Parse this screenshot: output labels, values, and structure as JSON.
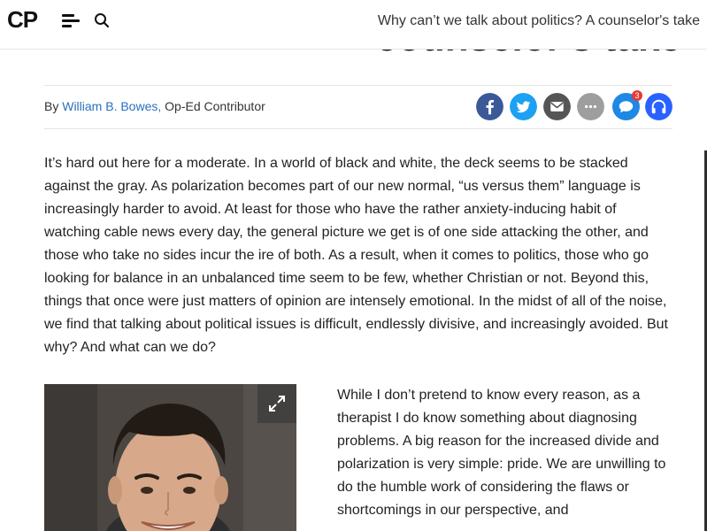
{
  "nav": {
    "logo": "CP",
    "title": "Why can’t we talk about politics? A counselor's take"
  },
  "headline": {
    "partial": "counselor's take"
  },
  "byline": {
    "prefix": "By ",
    "author": "William B. Bowes,",
    "role": " Op-Ed Contributor"
  },
  "share": {
    "comment_count": "3",
    "buttons": [
      "facebook-icon",
      "twitter-icon",
      "email-icon",
      "more-icon",
      "comments-icon",
      "podcast-icon"
    ],
    "colors": {
      "facebook": "#3b5998",
      "twitter": "#1da1f2",
      "email": "#555555",
      "more": "#9e9e9e",
      "comments": "#1e88e5",
      "podcast": "#2962ff"
    }
  },
  "article": {
    "paragraph1": "It’s hard out here for a moderate. In a world of black and white, the deck seems to be stacked against the gray. As polarization becomes part of our new normal, “us versus them” language is increasingly harder to avoid. At least for those who have the rather anxiety-inducing habit of watching cable news every day, the general picture we get is of one side attacking the other, and those who take no sides incur the ire of both. As a result, when it comes to politics, those who go looking for balance in an unbalanced time seem to be few, whether Christian or not. Beyond this, things that once were just matters of opinion are intensely emotional. In the midst of all of the noise, we find that talking about political issues is difficult, endlessly divisive, and increasingly avoided. But why? And what can we do?",
    "paragraph2": "While I don’t pretend to know every reason, as a therapist I do know something about diagnosing problems. A big reason for the increased divide and polarization is very simple: pride. We are unwilling to do the humble work of considering the flaws or shortcomings in our perspective, and"
  }
}
